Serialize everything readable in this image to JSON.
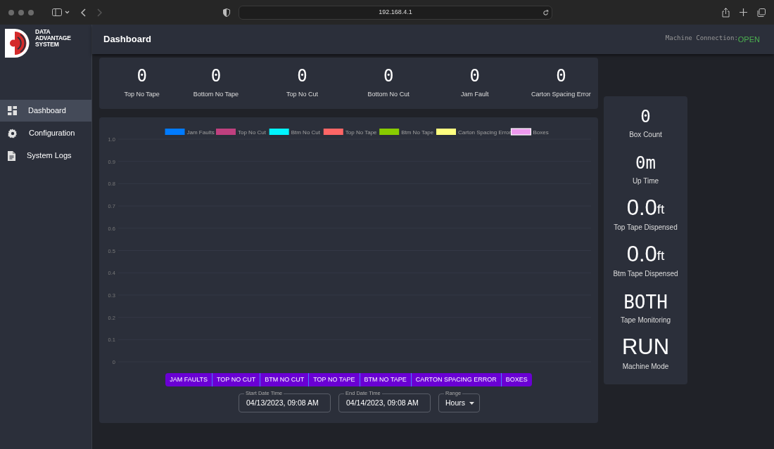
{
  "browser": {
    "address": "192.168.4.1"
  },
  "sidebar": {
    "logo_text": [
      "DATA",
      "ADVANTAGE",
      "SYSTEM"
    ],
    "items": [
      {
        "label": "Dashboard",
        "selected": true
      },
      {
        "label": "Configuration",
        "selected": false
      },
      {
        "label": "System Logs",
        "selected": false
      }
    ]
  },
  "header": {
    "title": "Dashboard",
    "connection_label": "Machine Connection:",
    "connection_status": "OPEN"
  },
  "fault_counts": [
    {
      "value": "0",
      "label": "Top No Tape"
    },
    {
      "value": "0",
      "label": "Bottom No Tape"
    },
    {
      "value": "0",
      "label": "Top No Cut"
    },
    {
      "value": "0",
      "label": "Bottom No Cut"
    },
    {
      "value": "0",
      "label": "Jam Fault"
    },
    {
      "value": "0",
      "label": "Carton Spacing Error"
    }
  ],
  "chart": {
    "chart_data": {
      "type": "line",
      "grid": true,
      "ylim": [
        0,
        1
      ],
      "yticks": [
        0,
        0.1,
        0.2,
        0.3,
        0.4,
        0.5,
        0.6,
        0.7,
        0.8,
        0.9,
        {
          "value": 1,
          "label": "1.0"
        }
      ],
      "series": [
        {
          "name": "Jam Faults",
          "color": "#007bff"
        },
        {
          "name": "Top No Cut",
          "color": "#c0407f"
        },
        {
          "name": "Btm No Cut",
          "color": "#00f5ff"
        },
        {
          "name": "Top No Tape",
          "color": "#ff6666"
        },
        {
          "name": "Btm No Tape",
          "color": "#88cc00"
        },
        {
          "name": "Carton Spacing Error",
          "color": "#ffff80"
        },
        {
          "name": "Boxes",
          "color": "#ee99ee"
        }
      ]
    },
    "filter_buttons": [
      "JAM FAULTS",
      "TOP NO CUT",
      "BTM NO CUT",
      "TOP NO TAPE",
      "BTM NO TAPE",
      "CARTON SPACING ERROR",
      "BOXES"
    ],
    "start": {
      "label": "Start Date Time",
      "value": "04/13/2023, 09:08 AM"
    },
    "end": {
      "label": "End Date Time",
      "value": "04/14/2023, 09:08 AM"
    },
    "range": {
      "label": "Range",
      "value": "Hours"
    }
  },
  "stats": [
    {
      "kind": "counter",
      "value": "0",
      "label": "Box Count"
    },
    {
      "kind": "counter",
      "value": "0m",
      "label": "Up Time"
    },
    {
      "kind": "reading",
      "value": "0.0",
      "unit": "ft",
      "label": "Top Tape Dispensed"
    },
    {
      "kind": "reading",
      "value": "0.0",
      "unit": "ft",
      "label": "Btm Tape Dispensed"
    },
    {
      "kind": "counter",
      "value": "BOTH",
      "label": "Tape Monitoring"
    },
    {
      "kind": "reading",
      "value": "RUN",
      "label": "Machine Mode"
    }
  ]
}
